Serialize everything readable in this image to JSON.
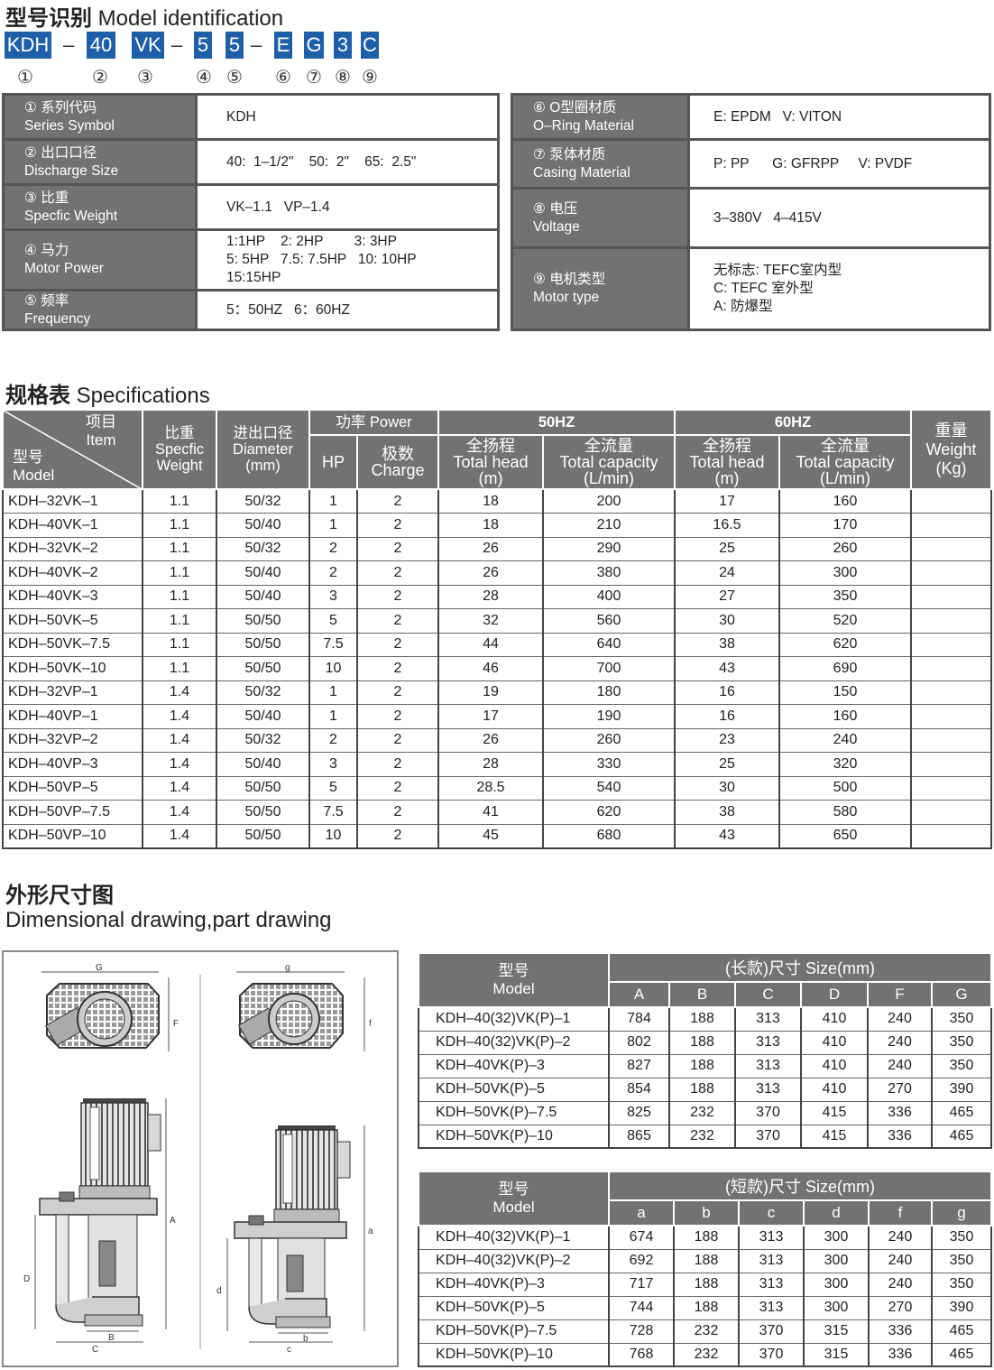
{
  "model_id": {
    "title_cn": "型号识别",
    "title_en": "Model identification",
    "codes": [
      "KDH",
      "40",
      "VK",
      "5",
      "5",
      "E",
      "G",
      "3",
      "C"
    ],
    "dash": "–",
    "numbers": [
      "①",
      "②",
      "③",
      "④",
      "⑤",
      "⑥",
      "⑦",
      "⑧",
      "⑨"
    ],
    "left_rows": [
      {
        "num": "①",
        "cn": "系列代码",
        "en": "Series Symbol",
        "value": [
          "KDH"
        ]
      },
      {
        "num": "②",
        "cn": "出口口径",
        "en": "Discharge Size",
        "value": [
          "40:  1–1/2\"    50:  2\"    65:  2.5\""
        ]
      },
      {
        "num": "③",
        "cn": "比重",
        "en": "Specfic Weight",
        "value": [
          "VK–1.1   VP–1.4"
        ]
      },
      {
        "num": "④",
        "cn": "马力",
        "en": "Motor Power",
        "value": [
          "1:1HP    2: 2HP        3: 3HP",
          "5: 5HP   7.5: 7.5HP   10: 10HP",
          "15:15HP"
        ]
      },
      {
        "num": "⑤",
        "cn": "频率",
        "en": "Frequency",
        "value": [
          "5：50HZ   6：60HZ"
        ]
      }
    ],
    "right_rows": [
      {
        "num": "⑥",
        "cn": "O型圈材质",
        "en": "O–Ring Material",
        "value": [
          "E: EPDM   V: VITON"
        ]
      },
      {
        "num": "⑦",
        "cn": "泵体材质",
        "en": "Casing Material",
        "value": [
          "P: PP      G: GFRPP     V: PVDF"
        ]
      },
      {
        "num": "⑧",
        "cn": "电压",
        "en": "Voltage",
        "value": [
          "3–380V   4–415V"
        ]
      },
      {
        "num": "⑨",
        "cn": "电机类型",
        "en": "Motor type",
        "value": [
          "无标志: TEFC室内型",
          "C: TEFC 室外型",
          "A: 防爆型"
        ]
      }
    ]
  },
  "specs": {
    "title_cn": "规格表",
    "title_en": "Specifications",
    "headers": {
      "item_cn": "项目",
      "item_en": "Item",
      "model_cn": "型号",
      "model_en": "Model",
      "sw_cn": "比重",
      "sw_en1": "Specfic",
      "sw_en2": "Weight",
      "dia_cn": "进出口径",
      "dia_en": "Diameter",
      "dia_unit": "(mm)",
      "power": "功率 Power",
      "hp": "HP",
      "charge_cn": "极数",
      "charge_en": "Charge",
      "hz50": "50HZ",
      "hz60": "60HZ",
      "head_cn": "全扬程",
      "head_en": "Total head",
      "head_unit": "(m)",
      "cap_cn": "全流量",
      "cap_en": "Total capacity",
      "cap_unit": "(L/min)",
      "wt_cn": "重量",
      "wt_en": "Weight",
      "wt_unit": "(Kg)"
    },
    "rows": [
      [
        "KDH–32VK–1",
        "1.1",
        "50/32",
        "1",
        "2",
        "18",
        "200",
        "17",
        "160",
        ""
      ],
      [
        "KDH–40VK–1",
        "1.1",
        "50/40",
        "1",
        "2",
        "18",
        "210",
        "16.5",
        "170",
        ""
      ],
      [
        "KDH–32VK–2",
        "1.1",
        "50/32",
        "2",
        "2",
        "26",
        "290",
        "25",
        "260",
        ""
      ],
      [
        "KDH–40VK–2",
        "1.1",
        "50/40",
        "2",
        "2",
        "26",
        "380",
        "24",
        "300",
        ""
      ],
      [
        "KDH–40VK–3",
        "1.1",
        "50/40",
        "3",
        "2",
        "28",
        "400",
        "27",
        "350",
        ""
      ],
      [
        "KDH–50VK–5",
        "1.1",
        "50/50",
        "5",
        "2",
        "32",
        "560",
        "30",
        "520",
        ""
      ],
      [
        "KDH–50VK–7.5",
        "1.1",
        "50/50",
        "7.5",
        "2",
        "44",
        "640",
        "38",
        "620",
        ""
      ],
      [
        "KDH–50VK–10",
        "1.1",
        "50/50",
        "10",
        "2",
        "46",
        "700",
        "43",
        "690",
        ""
      ],
      [
        "KDH–32VP–1",
        "1.4",
        "50/32",
        "1",
        "2",
        "19",
        "180",
        "16",
        "150",
        ""
      ],
      [
        "KDH–40VP–1",
        "1.4",
        "50/40",
        "1",
        "2",
        "17",
        "190",
        "16",
        "160",
        ""
      ],
      [
        "KDH–32VP–2",
        "1.4",
        "50/32",
        "2",
        "2",
        "26",
        "260",
        "23",
        "240",
        ""
      ],
      [
        "KDH–40VP–3",
        "1.4",
        "50/40",
        "3",
        "2",
        "28",
        "330",
        "25",
        "320",
        ""
      ],
      [
        "KDH–50VP–5",
        "1.4",
        "50/50",
        "5",
        "2",
        "28.5",
        "540",
        "30",
        "500",
        ""
      ],
      [
        "KDH–50VP–7.5",
        "1.4",
        "50/50",
        "7.5",
        "2",
        "41",
        "620",
        "38",
        "580",
        ""
      ],
      [
        "KDH–50VP–10",
        "1.4",
        "50/50",
        "10",
        "2",
        "45",
        "680",
        "43",
        "650",
        ""
      ]
    ]
  },
  "dimensions": {
    "title_cn": "外形尺寸图",
    "title_en": "Dimensional drawing,part drawing",
    "drawing_labels": {
      "long": {
        "G": "G",
        "F": "F",
        "A": "A",
        "D": "D",
        "B": "B",
        "C": "C"
      },
      "short": {
        "g": "g",
        "f": "f",
        "a": "a",
        "d": "d",
        "b": "b",
        "c": "c"
      }
    },
    "long_table": {
      "model_cn": "型号",
      "model_en": "Model",
      "title": "(长款)尺寸 Size(mm)",
      "cols": [
        "A",
        "B",
        "C",
        "D",
        "F",
        "G"
      ],
      "rows": [
        [
          "KDH–40(32)VK(P)–1",
          "784",
          "188",
          "313",
          "410",
          "240",
          "350"
        ],
        [
          "KDH–40(32)VK(P)–2",
          "802",
          "188",
          "313",
          "410",
          "240",
          "350"
        ],
        [
          "KDH–40VK(P)–3",
          "827",
          "188",
          "313",
          "410",
          "240",
          "350"
        ],
        [
          "KDH–50VK(P)–5",
          "854",
          "188",
          "313",
          "410",
          "270",
          "390"
        ],
        [
          "KDH–50VK(P)–7.5",
          "825",
          "232",
          "370",
          "415",
          "336",
          "465"
        ],
        [
          "KDH–50VK(P)–10",
          "865",
          "232",
          "370",
          "415",
          "336",
          "465"
        ]
      ]
    },
    "short_table": {
      "model_cn": "型号",
      "model_en": "Model",
      "title": "(短款)尺寸 Size(mm)",
      "cols": [
        "a",
        "b",
        "c",
        "d",
        "f",
        "g"
      ],
      "rows": [
        [
          "KDH–40(32)VK(P)–1",
          "674",
          "188",
          "313",
          "300",
          "240",
          "350"
        ],
        [
          "KDH–40(32)VK(P)–2",
          "692",
          "188",
          "313",
          "300",
          "240",
          "350"
        ],
        [
          "KDH–40VK(P)–3",
          "717",
          "188",
          "313",
          "300",
          "240",
          "350"
        ],
        [
          "KDH–50VK(P)–5",
          "744",
          "188",
          "313",
          "300",
          "270",
          "390"
        ],
        [
          "KDH–50VK(P)–7.5",
          "728",
          "232",
          "370",
          "315",
          "336",
          "465"
        ],
        [
          "KDH–50VK(P)–10",
          "768",
          "232",
          "370",
          "315",
          "336",
          "465"
        ]
      ]
    }
  }
}
